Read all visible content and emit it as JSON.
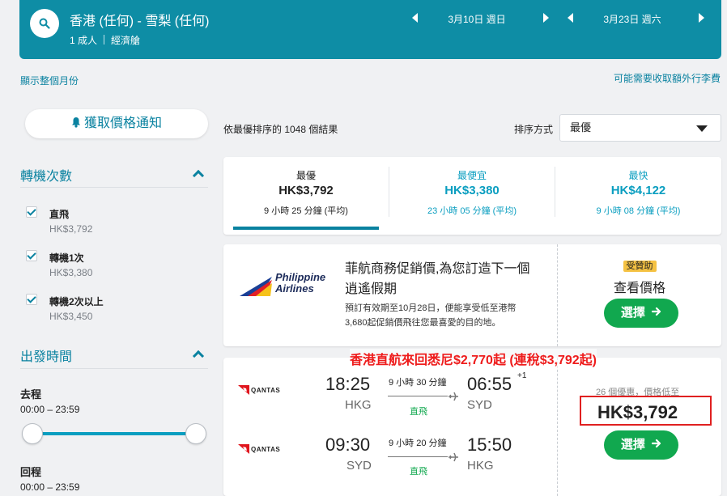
{
  "header": {
    "route": "香港 (任何) - 雪梨 (任何)",
    "passengers": "1 成人",
    "cabin": "經濟艙",
    "depart_date": "3月10日 週日",
    "return_date": "3月23日 週六"
  },
  "links": {
    "show_month": "顯示整個月份",
    "baggage_fees": "可能需要收取額外行李費"
  },
  "sidebar": {
    "price_alert": "獲取價格通知",
    "stops_title": "轉機次數",
    "stops": [
      {
        "label": "直飛",
        "price": "HK$3,792",
        "checked": true
      },
      {
        "label": "轉機1次",
        "price": "HK$3,380",
        "checked": true
      },
      {
        "label": "轉機2次以上",
        "price": "HK$3,450",
        "checked": true
      }
    ],
    "departure_title": "出發時間",
    "outbound_label": "去程",
    "outbound_range": "00:00 – 23:59",
    "return_label": "回程",
    "return_range": "00:00 – 23:59"
  },
  "results": {
    "count_text": "依最優排序的 1048 個結果",
    "sort_label": "排序方式",
    "sort_value": "最優"
  },
  "tabs": [
    {
      "title": "最優",
      "price": "HK$3,792",
      "duration": "9 小時 25 分鐘 (平均)",
      "active": true
    },
    {
      "title": "最便宜",
      "price": "HK$3,380",
      "duration": "23 小時 05 分鐘 (平均)",
      "active": false
    },
    {
      "title": "最快",
      "price": "HK$4,122",
      "duration": "9 小時 08 分鐘 (平均)",
      "active": false
    }
  ],
  "ad": {
    "airline_line1": "Philippine",
    "airline_line2": "Airlines",
    "headline_line1": "菲航商務促銷價,為您訂造下一個",
    "headline_line2": "逍遙假期",
    "body_line1": "預訂有效期至10月28日，便能享受低至港幣",
    "body_line2": "3,680起促銷價飛往您最喜愛的目的地。",
    "badge": "受贊助",
    "cta_title": "查看價格",
    "button": "選擇"
  },
  "promo_banner": "香港直航來回悉尼$2,770起 (連稅$3,792起)",
  "flight": {
    "airline_logo": "QANTAS",
    "outbound": {
      "depart_time": "18:25",
      "depart_ap": "HKG",
      "duration": "9 小時 30 分鐘",
      "stops": "直飛",
      "arrive_time": "06:55",
      "day_offset": "+1",
      "arrive_ap": "SYD"
    },
    "inbound": {
      "depart_time": "09:30",
      "depart_ap": "SYD",
      "duration": "9 小時 20 分鐘",
      "stops": "直飛",
      "arrive_time": "15:50",
      "arrive_ap": "HKG"
    },
    "deals": "26 個優惠，價格低至",
    "price": "HK$3,792",
    "button": "選擇"
  },
  "colors": {
    "header_bg": "#0e8da5",
    "accent": "#0a82a0",
    "select_button": "#11a84f",
    "highlight_red": "#e02020"
  }
}
